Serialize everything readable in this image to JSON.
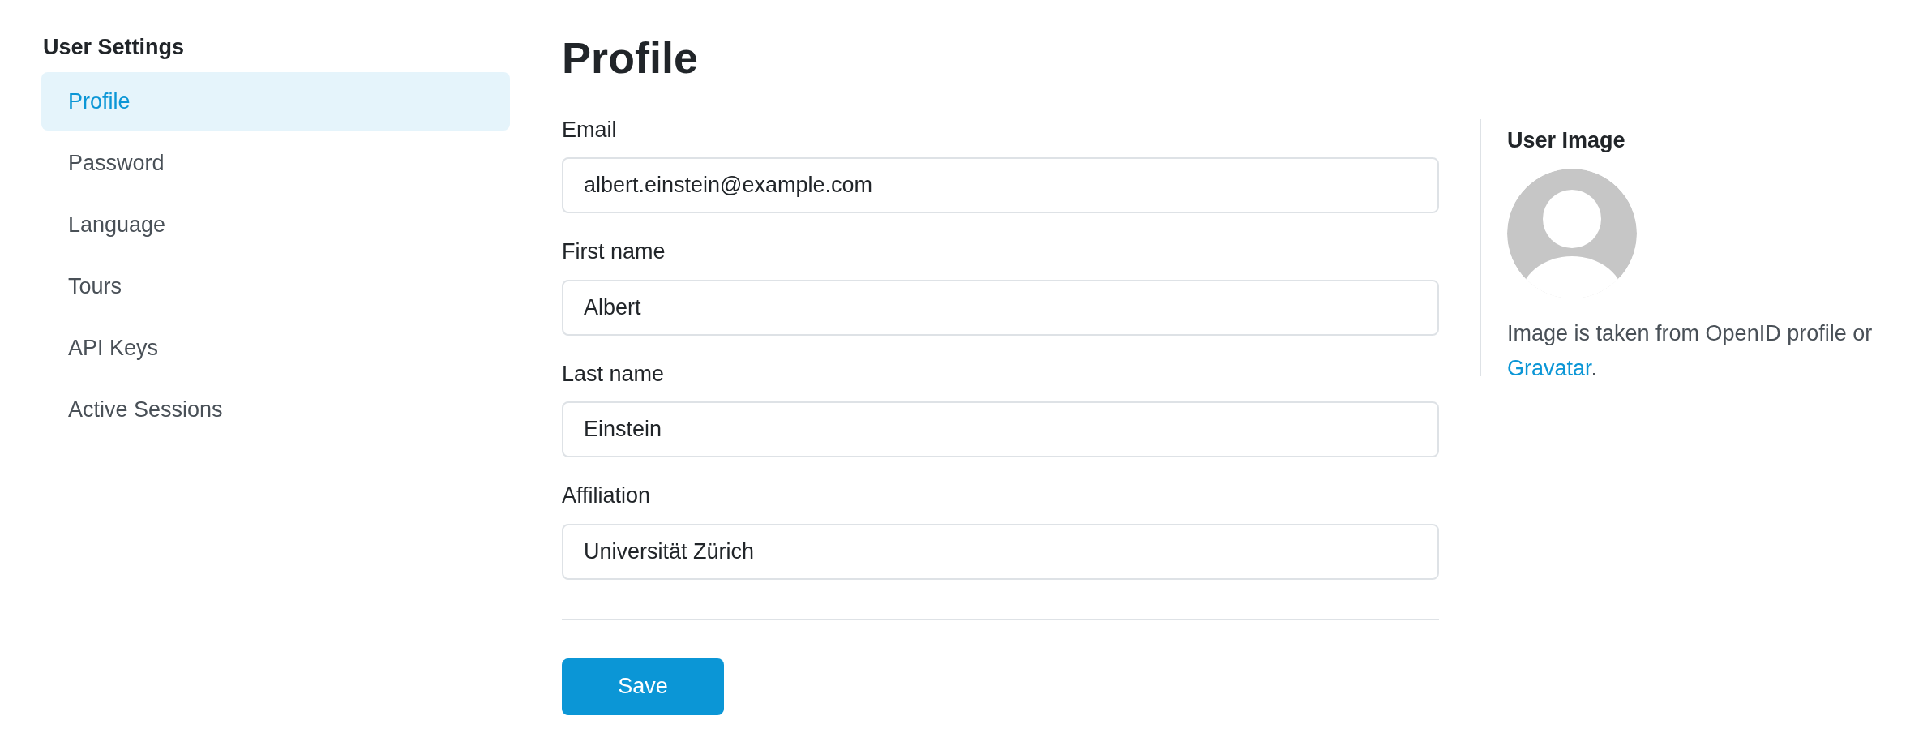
{
  "sidebar": {
    "title": "User Settings",
    "items": [
      {
        "label": "Profile",
        "selected": true
      },
      {
        "label": "Password",
        "selected": false
      },
      {
        "label": "Language",
        "selected": false
      },
      {
        "label": "Tours",
        "selected": false
      },
      {
        "label": "API Keys",
        "selected": false
      },
      {
        "label": "Active Sessions",
        "selected": false
      }
    ]
  },
  "profile": {
    "title": "Profile",
    "fields": [
      {
        "label": "Email",
        "value": "albert.einstein@example.com"
      },
      {
        "label": "First name",
        "value": "Albert"
      },
      {
        "label": "Last name",
        "value": "Einstein"
      },
      {
        "label": "Affiliation",
        "value": "Universität Zürich"
      }
    ],
    "save_button": "Save"
  },
  "user_image": {
    "title": "User Image",
    "note": "Image is taken from OpenID profile or",
    "link": "Gravatar",
    "note_end": "."
  }
}
